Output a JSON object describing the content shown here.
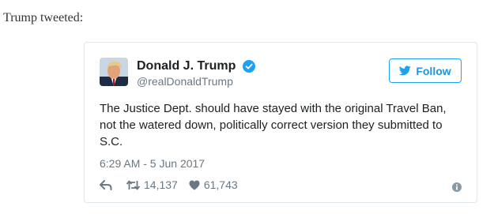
{
  "intro_text": "Trump tweeted:",
  "tweet": {
    "display_name": "Donald J. Trump",
    "handle": "@realDonaldTrump",
    "verified": true,
    "follow_label": "Follow",
    "text": "The Justice Dept. should have stayed with the original Travel Ban, not the watered down, politically correct version they submitted to S.C.",
    "timestamp": "6:29 AM - 5 Jun 2017",
    "retweet_count": "14,137",
    "like_count": "61,743",
    "icons": [
      "verified-badge-icon",
      "twitter-bird-icon",
      "reply-icon",
      "retweet-icon",
      "heart-icon",
      "info-icon"
    ]
  },
  "colors": {
    "accent": "#1da1f2",
    "muted": "#697882",
    "border": "#e1e8ed"
  }
}
